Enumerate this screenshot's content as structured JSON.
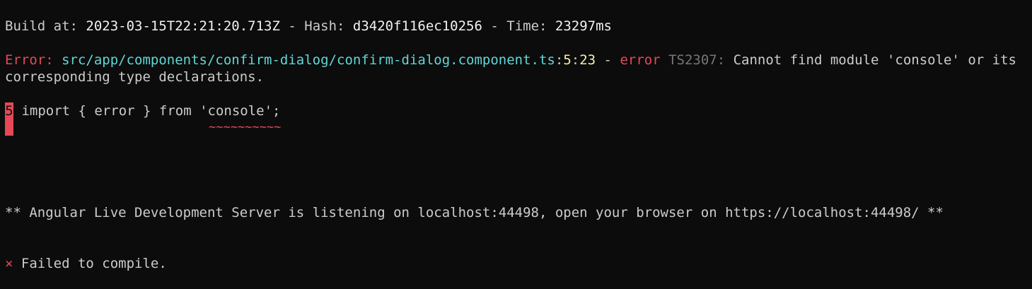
{
  "window": {
    "title": ""
  },
  "build": {
    "label_build_at": "Build at: ",
    "timestamp": "2023-03-15T22:21:20.713Z",
    "sep1": " - ",
    "label_hash": "Hash: ",
    "hash": "d3420f116ec10256",
    "sep2": " - ",
    "label_time": "Time: ",
    "time": "23297ms"
  },
  "error": {
    "prefix": "Error: ",
    "file": "src/app/components/confirm-dialog/confirm-dialog.component.ts",
    "colon1": ":",
    "line": "5",
    "colon2": ":",
    "col": "23",
    "sep": " - ",
    "severity": "error",
    "code": " TS2307:",
    "message": " Cannot find module 'console' or its corresponding type declarations."
  },
  "code_snippet": {
    "line_number": "5",
    "code": " import { error } from 'console';",
    "underline": "~~~~~~~~~~"
  },
  "server": {
    "message": "** Angular Live Development Server is listening on localhost:44498, open your browser on https://localhost:44498/ **"
  },
  "status": {
    "icon": "×",
    "message": " Failed to compile."
  },
  "colors": {
    "background": "#0c0c0c",
    "text": "#cccccc",
    "error_red": "#e74856",
    "path_cyan": "#61d6d6",
    "location_yellow": "#f9f1a5",
    "code_gray": "#767676"
  }
}
